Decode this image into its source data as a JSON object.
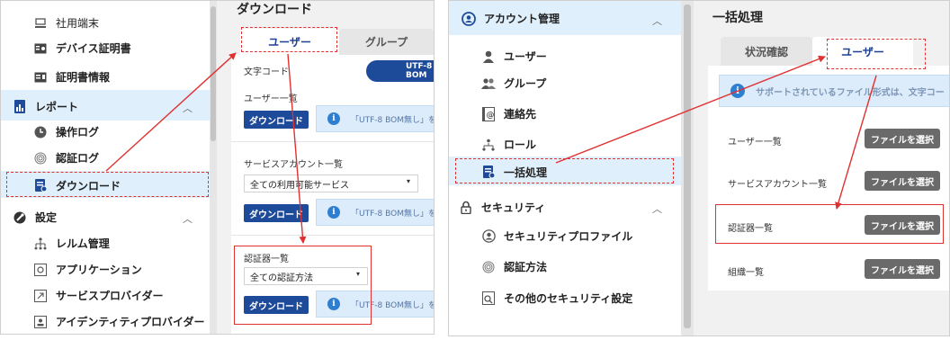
{
  "left": {
    "sidebar": {
      "items": [
        {
          "label": "社用端末",
          "icon": "device-icon"
        },
        {
          "label": "デバイス証明書",
          "icon": "device-certificate-icon"
        },
        {
          "label": "証明書情報",
          "icon": "certificate-info-icon"
        },
        {
          "label": "レポート",
          "icon": "report-icon"
        },
        {
          "label": "操作ログ",
          "icon": "clock-icon"
        },
        {
          "label": "認証ログ",
          "icon": "fingerprint-icon"
        },
        {
          "label": "ダウンロード",
          "icon": "download-icon"
        },
        {
          "label": "設定",
          "icon": "settings-icon"
        },
        {
          "label": "レルム管理",
          "icon": "realm-icon"
        },
        {
          "label": "アプリケーション",
          "icon": "application-icon"
        },
        {
          "label": "サービスプロバイダー",
          "icon": "service-provider-icon"
        },
        {
          "label": "アイデンティティプロバイダー",
          "icon": "identity-provider-icon"
        }
      ]
    },
    "main": {
      "heading": "ダウンロード",
      "tabs": [
        {
          "label": "ユーザー",
          "active": true
        },
        {
          "label": "グループ",
          "active": false
        }
      ],
      "encoding_label": "文字コード",
      "encoding_value": "UTF-8 BOM",
      "user_list_label": "ユーザー一覧",
      "service_account_label": "サービスアカウント一覧",
      "service_select_value": "全ての利用可能サービス",
      "authenticator_label": "認証器一覧",
      "authenticator_select_value": "全ての認証方法",
      "download_label": "ダウンロード",
      "info_text": "「UTF-8 BOM無し」を"
    }
  },
  "right": {
    "sidebar": {
      "items": [
        {
          "label": "アカウント管理",
          "icon": "account-icon"
        },
        {
          "label": "ユーザー",
          "icon": "user-icon"
        },
        {
          "label": "グループ",
          "icon": "group-icon"
        },
        {
          "label": "連絡先",
          "icon": "contact-icon"
        },
        {
          "label": "ロール",
          "icon": "role-icon"
        },
        {
          "label": "一括処理",
          "icon": "bulk-icon"
        },
        {
          "label": "セキュリティ",
          "icon": "lock-icon"
        },
        {
          "label": "セキュリティプロファイル",
          "icon": "security-profile-icon"
        },
        {
          "label": "認証方法",
          "icon": "fingerprint-icon"
        },
        {
          "label": "その他のセキュリティ設定",
          "icon": "other-security-icon"
        }
      ]
    },
    "main": {
      "heading": "一括処理",
      "tabs": [
        {
          "label": "状況確認",
          "active": false
        },
        {
          "label": "ユーザー",
          "active": true
        }
      ],
      "info_text": "サポートされているファイル形式は、文字コー",
      "rows": [
        {
          "label": "ユーザー一覧"
        },
        {
          "label": "サービスアカウント一覧"
        },
        {
          "label": "認証器一覧"
        },
        {
          "label": "組織一覧"
        }
      ],
      "file_button_label": "ファイルを選択"
    }
  },
  "colors": {
    "accent": "#1e4a9a",
    "highlight": "#e03131",
    "selected_bg": "#dfeffb"
  }
}
